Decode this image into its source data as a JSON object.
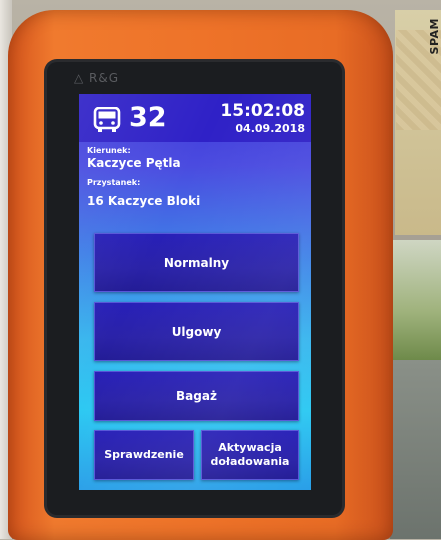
{
  "side_brand": "SPAM",
  "device_logo": "R&G",
  "header": {
    "line_number": "32",
    "time": "15:02:08",
    "date": "04.09.2018"
  },
  "info": {
    "direction_label": "Kierunek:",
    "direction_value": "Kaczyce Pętla",
    "stop_label": "Przystanek:",
    "stop_value": "16 Kaczyce Bloki"
  },
  "buttons": {
    "normal": "Normalny",
    "reduced": "Ulgowy",
    "baggage": "Bagaż",
    "check": "Sprawdzenie",
    "activation_line1": "Aktywacja",
    "activation_line2": "doładowania"
  },
  "colors": {
    "housing": "#ee7329",
    "screen_header": "#2f21c7",
    "button": "#2820b8"
  },
  "icons": {
    "bus": "bus-icon"
  }
}
